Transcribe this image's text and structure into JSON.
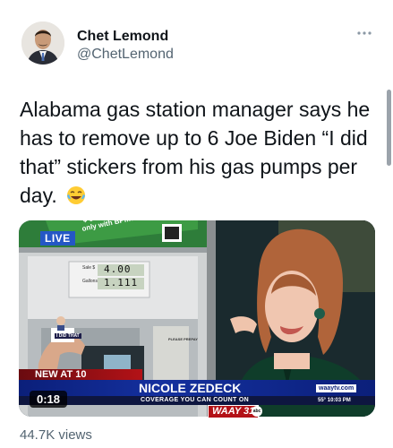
{
  "author": {
    "name": "Chet Lemond",
    "handle": "@ChetLemond"
  },
  "more_icon": "ellipsis-icon",
  "tweet": {
    "text": "Alabama gas station manager says he has to remove up to 6 Joe Biden “I did that” stickers from his gas pumps per day.",
    "emoji": "face-with-tears-of-joy"
  },
  "video": {
    "duration": "0:18",
    "overlay": {
      "promo_line1": "¢ cents off every gallon",
      "promo_line2": "only with BPme Rewards",
      "live": "LIVE",
      "pump_sale": "Sale $",
      "pump_gallons": "Gallons",
      "lcd_sale": "4.00",
      "lcd_gallons": "1.111",
      "sticker": "I DID THAT",
      "prepay": "PLEASE PREPAY",
      "new_at": "NEW AT 10",
      "reporter": "NICOLE ZEDECK",
      "tagline": "COVERAGE YOU CAN COUNT ON",
      "website": "waaytv.com",
      "weather_time": "55°   10:03 PM",
      "station": "WAAY 31",
      "network": "abc"
    }
  },
  "stats": {
    "views": "44.7K views"
  }
}
